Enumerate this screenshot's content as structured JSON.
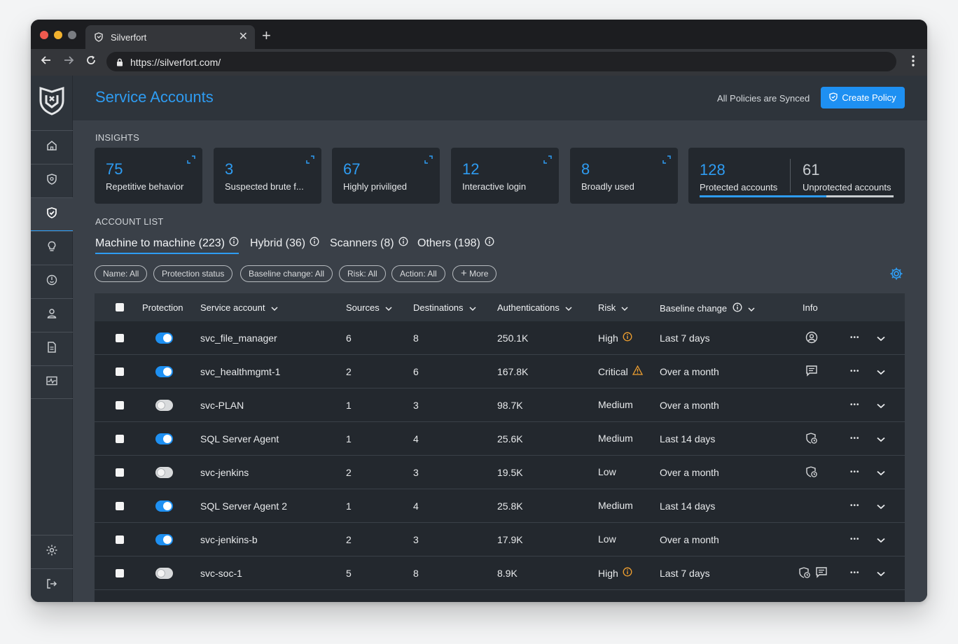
{
  "browser": {
    "tab_title": "Silverfort",
    "tab_close": "✕",
    "new_tab": "+",
    "url": "https://silverfort.com/"
  },
  "colors": {
    "accent": "#1e90f2",
    "title_blue": "#2e9cf2",
    "warning_orange": "#f0a030",
    "background": "#3a4048",
    "panel": "#23282e"
  },
  "sidebar": {
    "items": [
      {
        "icon": "home-icon"
      },
      {
        "icon": "shield-lock-icon"
      },
      {
        "icon": "shield-check-icon",
        "active": true
      },
      {
        "icon": "lightbulb-icon"
      },
      {
        "icon": "fingerprint-icon"
      },
      {
        "icon": "user-icon"
      },
      {
        "icon": "document-icon"
      },
      {
        "icon": "activity-icon"
      }
    ],
    "bottom": [
      {
        "icon": "gear-icon"
      },
      {
        "icon": "logout-icon"
      }
    ]
  },
  "header": {
    "title": "Service Accounts",
    "sync_status": "All Policies are Synced",
    "create_button": "Create Policy"
  },
  "insights": {
    "section_label": "INSIGHTS",
    "cards": [
      {
        "value": "75",
        "label": "Repetitive behavior"
      },
      {
        "value": "3",
        "label": "Suspected brute f..."
      },
      {
        "value": "67",
        "label": "Highly priviliged"
      },
      {
        "value": "12",
        "label": "Interactive login"
      },
      {
        "value": "8",
        "label": "Broadly used"
      }
    ],
    "protected": {
      "value": "128",
      "label": "Protected accounts"
    },
    "unprotected": {
      "value": "61",
      "label": "Unprotected accounts"
    }
  },
  "account_list": {
    "section_label": "ACCOUNT LIST",
    "tabs": [
      {
        "label": "Machine to machine (223)",
        "active": true
      },
      {
        "label": "Hybrid (36)"
      },
      {
        "label": "Scanners (8)"
      },
      {
        "label": "Others (198)"
      }
    ],
    "filters": [
      "Name: All",
      "Protection status",
      "Baseline change: All",
      "Risk: All",
      "Action: All",
      "More"
    ],
    "more_prefix": "+"
  },
  "table": {
    "columns": {
      "protection": "Protection",
      "service_account": "Service account",
      "sources": "Sources",
      "destinations": "Destinations",
      "authentications": "Authentications",
      "risk": "Risk",
      "baseline_change": "Baseline change",
      "info": "Info"
    },
    "more_glyph": "•••",
    "rows": [
      {
        "protected": true,
        "name": "svc_file_manager",
        "sources": "6",
        "destinations": "8",
        "auths": "250.1K",
        "risk": "High",
        "risk_icon": "info-circle-icon",
        "baseline": "Last 7 days",
        "info": [
          "user-circle-icon"
        ]
      },
      {
        "protected": true,
        "name": "svc_healthmgmt-1",
        "sources": "2",
        "destinations": "6",
        "auths": "167.8K",
        "risk": "Critical",
        "risk_icon": "warning-triangle-icon",
        "baseline": "Over a month",
        "info": [
          "comment-icon"
        ]
      },
      {
        "protected": false,
        "name": "svc-PLAN",
        "sources": "1",
        "destinations": "3",
        "auths": "98.7K",
        "risk": "Medium",
        "risk_icon": "",
        "baseline": "Over a month",
        "info": []
      },
      {
        "protected": true,
        "name": "SQL Server Agent",
        "sources": "1",
        "destinations": "4",
        "auths": "25.6K",
        "risk": "Medium",
        "risk_icon": "",
        "baseline": "Last 14 days",
        "info": [
          "shield-clock-icon"
        ]
      },
      {
        "protected": false,
        "name": "svc-jenkins",
        "sources": "2",
        "destinations": "3",
        "auths": "19.5K",
        "risk": "Low",
        "risk_icon": "",
        "baseline": "Over a month",
        "info": [
          "shield-clock-icon"
        ]
      },
      {
        "protected": true,
        "name": "SQL Server Agent 2",
        "sources": "1",
        "destinations": "4",
        "auths": "25.8K",
        "risk": "Medium",
        "risk_icon": "",
        "baseline": "Last 14 days",
        "info": []
      },
      {
        "protected": true,
        "name": "svc-jenkins-b",
        "sources": "2",
        "destinations": "3",
        "auths": "17.9K",
        "risk": "Low",
        "risk_icon": "",
        "baseline": "Over a month",
        "info": []
      },
      {
        "protected": false,
        "name": "svc-soc-1",
        "sources": "5",
        "destinations": "8",
        "auths": "8.9K",
        "risk": "High",
        "risk_icon": "info-circle-icon",
        "baseline": "Last 7 days",
        "info": [
          "shield-clock-icon",
          "comment-icon"
        ]
      }
    ]
  }
}
